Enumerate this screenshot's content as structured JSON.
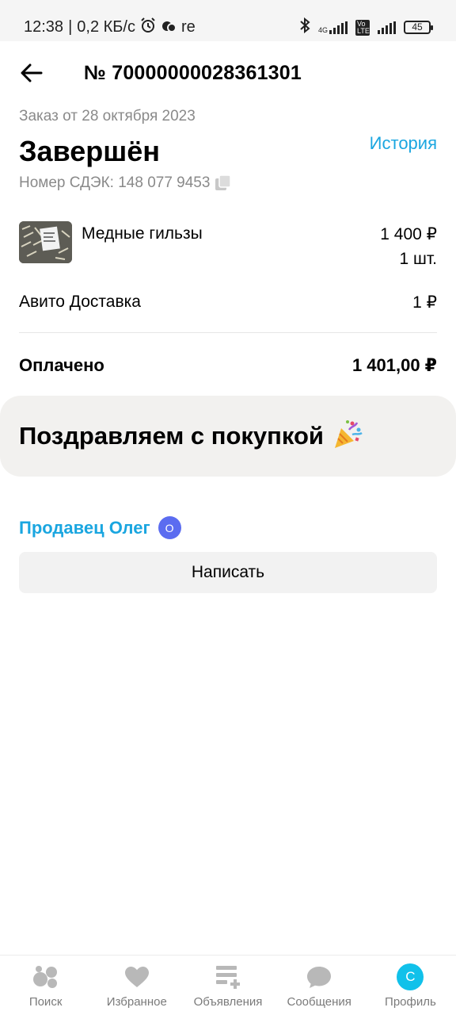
{
  "status_bar": {
    "time": "12:38",
    "speed": "0,2 КБ/с",
    "carrier_text": "re",
    "network_badge_top": "4G",
    "volte_text": "Vo LTE",
    "battery_level": "45"
  },
  "header": {
    "order_number": "№ 70000000028361301"
  },
  "order": {
    "date_text": "Заказ от 28 октября 2023",
    "status": "Завершён",
    "history_link": "История",
    "cdek_number": "Номер СДЭК: 148 077 9453"
  },
  "item": {
    "name": "Медные гильзы",
    "price": "1 400 ₽",
    "quantity": "1 шт."
  },
  "delivery": {
    "label": "Авито Доставка",
    "price": "1 ₽"
  },
  "payment": {
    "label": "Оплачено",
    "total": "1 401,00 ₽"
  },
  "congrats": {
    "text": "Поздравляем с покупкой"
  },
  "seller": {
    "name": "Продавец Олег",
    "badge_letter": "О",
    "write_button": "Написать"
  },
  "bottom_nav": {
    "items": [
      {
        "label": "Поиск",
        "icon": "search-bubbles-icon"
      },
      {
        "label": "Избранное",
        "icon": "heart-icon"
      },
      {
        "label": "Объявления",
        "icon": "listing-add-icon"
      },
      {
        "label": "Сообщения",
        "icon": "chat-bubble-icon"
      },
      {
        "label": "Профиль",
        "icon": "profile-avatar",
        "avatar_letter": "С"
      }
    ]
  },
  "colors": {
    "accent_blue": "#1aa6e0",
    "avatar_cyan": "#11c1ea",
    "seller_badge": "#5b6cf0"
  }
}
